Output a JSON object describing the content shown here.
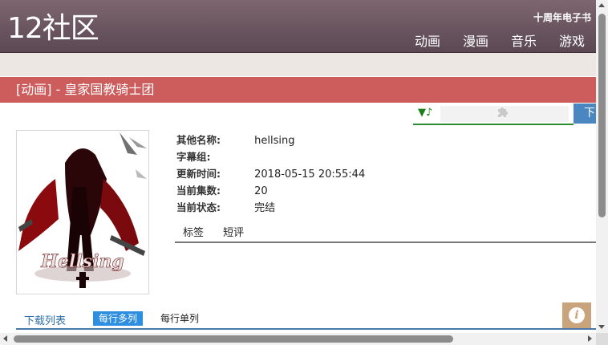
{
  "header": {
    "logo": "12社区",
    "anniversary": "十周年电子书",
    "nav": [
      "动画",
      "漫画",
      "音乐",
      "游戏"
    ]
  },
  "page": {
    "title": "[动画] - 皇家国教骑士团"
  },
  "player": {
    "control": "▼♪",
    "download_label": "下载"
  },
  "poster": {
    "title_text": "Hellsing"
  },
  "info": {
    "rows": [
      {
        "label": "其他名称:",
        "value": "hellsing"
      },
      {
        "label": "字幕组:",
        "value": ""
      },
      {
        "label": "更新时间:",
        "value": "2018-05-15 20:55:44"
      },
      {
        "label": "当前集数:",
        "value": "20"
      },
      {
        "label": "当前状态:",
        "value": "完结"
      }
    ]
  },
  "tabs": [
    "标签",
    "短评"
  ],
  "downloads": {
    "title": "下载列表",
    "multi_label": "每行多列",
    "single_label": "每行单列"
  },
  "info_button": "i",
  "colors": {
    "header": "#6e5963",
    "titlebar": "#cd5c5c",
    "accent_blue": "#2e8ee0",
    "info_button": "#c9a37c"
  }
}
